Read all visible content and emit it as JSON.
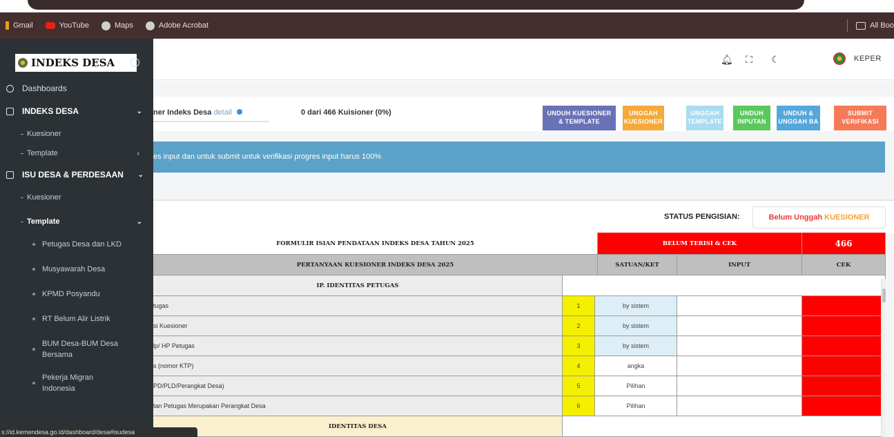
{
  "browser": {
    "bookmarks": [
      {
        "label": "Gmail",
        "icon": "gmail-icon"
      },
      {
        "label": "YouTube",
        "icon": "youtube-icon"
      },
      {
        "label": "Maps",
        "icon": "globe-icon"
      },
      {
        "label": "Adobe Acrobat",
        "icon": "globe-icon"
      }
    ],
    "all_bookmarks": "All Boo",
    "status_url": "s://id.kemendesa.go.id/dashboard/desa#isudesa"
  },
  "sidebar": {
    "brand": "INDEKS DESA",
    "items": {
      "dashboards": "Dashboards",
      "indeks_desa": "INDEKS DESA",
      "kuesioner1": "Kuesioner",
      "template1": "Template",
      "isu_desa": "ISU DESA & PERDESAAN",
      "kuesioner2": "Kuesioner",
      "template2": "Template",
      "petugas": "Petugas Desa dan LKD",
      "musyawarah": "Musyawarah Desa",
      "kpmd": "KPMD Posyandu",
      "rt_belum": "RT Belum Alir Listrik",
      "bum_line1": "BUM Desa-BUM Desa",
      "bum_line2": "Bersama",
      "pekerja_line1": "Pekerja Migran",
      "pekerja_line2": "Indonesia"
    }
  },
  "header": {
    "user": "KEPER"
  },
  "info": {
    "kuis_label": "ner Indeks Desa",
    "detail": "detail",
    "progress": "0 dari 466 Kuisioner (0%)",
    "buttons": {
      "unduh_kuesioner_1": "UNDUH KUESIONER",
      "unduh_kuesioner_2": "& TEMPLATE",
      "unggah_kuesioner_1": "UNGGAH",
      "unggah_kuesioner_2": "KUESIONER",
      "unggah_template_1": "UNGGAH",
      "unggah_template_2": "TEMPLATE",
      "unduh_inputan_1": "UNDUH",
      "unduh_inputan_2": "INPUTAN",
      "unduh_unggah_ba_1": "UNDUH &",
      "unduh_unggah_ba_2": "UNGGAH BA",
      "submit_1": "SUBMIT",
      "submit_2": "VERIFIKASI"
    },
    "button_colors": {
      "unduh_kuesioner": "#6a72b6",
      "unggah_kuesioner": "#f5a93c",
      "unggah_template": "#a9dcef",
      "unduh_inputan": "#5cc85c",
      "unduh_unggah_ba": "#56a6db",
      "submit": "#f57a5a"
    }
  },
  "alert": {
    "text": "es input dan untuk submit untuk verifikasi progres input harus 100%"
  },
  "status": {
    "label": "STATUS PENGISIAN:",
    "value_part1": "Belum Unggah",
    "value_part2": "KUESIONER"
  },
  "table": {
    "title": "FORMULIR ISIAN PENDATAAN INDEKS DESA TAHUN 2025",
    "belum_terisi": "BELUM TERISI & CEK",
    "count": "466",
    "col_question": "PERTANYAAN KUESIONER INDEKS DESA 2025",
    "col_satuan": "SATUAN/KET",
    "col_input": "INPUT",
    "col_cek": "CEK",
    "section1": "IP. IDENTITAS PETUGAS",
    "rows": [
      {
        "q": "tugas",
        "no": "1",
        "sat": "by sistem"
      },
      {
        "q": "si Kuesioner",
        "no": "2",
        "sat": "by sistem"
      },
      {
        "q": "lp/ HP Petugas",
        "no": "3",
        "sat": "by sistem"
      },
      {
        "q": "s (nomor KTP)",
        "no": "4",
        "sat": "angka"
      },
      {
        "q": "PD/PLD/Perangkat Desa)",
        "no": "5",
        "sat": "Pilihan"
      },
      {
        "q": "tan Petugas Merupakan Perangkat Desa",
        "no": "6",
        "sat": "Pilihan"
      }
    ],
    "section2": "IDENTITAS DESA"
  }
}
